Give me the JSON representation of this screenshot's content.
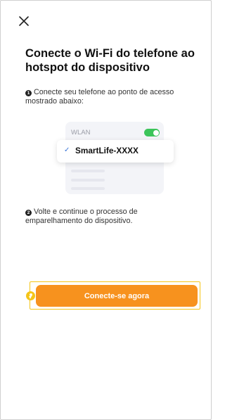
{
  "header": {
    "close_icon": "close-icon"
  },
  "title": "Conecte o Wi-Fi do telefone ao hotspot do dispositivo",
  "steps": [
    {
      "number": "1",
      "text": "Conecte seu telefone ao ponto de acesso mostrado abaixo:"
    },
    {
      "number": "2",
      "text": "Volte e continue o processo de emparelhamento do dispositivo."
    }
  ],
  "illustration": {
    "wlan_label": "WLAN",
    "toggle_on": true,
    "network_name": "SmartLife-XXXX",
    "check_mark": "✓"
  },
  "button": {
    "label": "Conecte-se agora"
  },
  "colors": {
    "accent": "#f7921e",
    "highlight": "#f5c518",
    "toggle": "#3cc45a",
    "check": "#3a76d8"
  }
}
